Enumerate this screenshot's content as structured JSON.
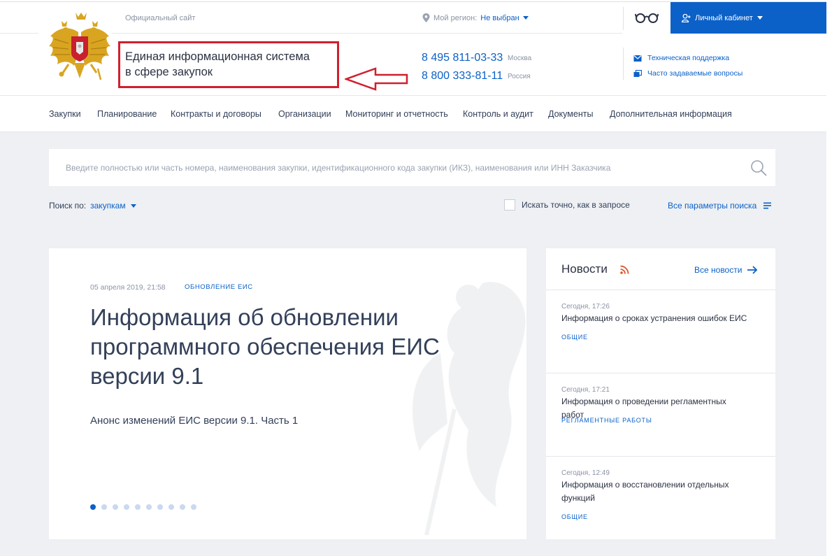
{
  "header": {
    "official_site": "Официальный сайт",
    "region_label": "Мой регион:",
    "region_value": "Не выбран",
    "cabinet_label": "Личный кабинет",
    "title_line1": "Единая информационная система",
    "title_line2": "в сфере закупок",
    "phones": [
      {
        "number": "8 495 811-03-33",
        "city": "Москва"
      },
      {
        "number": "8 800 333-81-11",
        "city": "Россия"
      }
    ],
    "support": [
      {
        "label": "Техническая поддержка",
        "icon": "mail-icon"
      },
      {
        "label": "Часто задаваемые вопросы",
        "icon": "faq-icon"
      }
    ]
  },
  "nav": {
    "items": [
      "Закупки",
      "Планирование",
      "Контракты и договоры",
      "Организации",
      "Мониторинг и отчетность",
      "Контроль и аудит",
      "Документы",
      "Дополнительная информация"
    ]
  },
  "search": {
    "placeholder": "Введите полностью или часть номера, наименования закупки, идентификационного кода закупки (ИКЗ), наименования или ИНН Заказчика",
    "value": "",
    "search_by_label": "Поиск по:",
    "search_by_value": "закупкам",
    "exact_label": "Искать точно, как в запросе",
    "all_params_label": "Все параметры поиска"
  },
  "featured": {
    "date": "05 апреля 2019, 21:58",
    "category": "ОБНОВЛЕНИЕ ЕИС",
    "title": "Информация об обновлении программного обеспечения ЕИС версии 9.1",
    "subtitle": "Анонс изменений ЕИС версии 9.1. Часть 1",
    "slides_total": 10,
    "active_slide": 1
  },
  "news": {
    "heading": "Новости",
    "all_label": "Все новости",
    "items": [
      {
        "time": "Сегодня, 17:26",
        "text": "Информация о сроках устранения ошибок ЕИС",
        "tag": "ОБЩИЕ"
      },
      {
        "time": "Сегодня, 17:21",
        "text": "Информация о проведении регламентных работ",
        "tag": "РЕГЛАМЕНТНЫЕ РАБОТЫ"
      },
      {
        "time": "Сегодня, 12:49",
        "text": "Информация о восстановлении отдельных функций",
        "tag": "ОБЩИЕ"
      }
    ]
  },
  "colors": {
    "accent": "#0b61c8",
    "highlight_box": "#d0202e",
    "background": "#eef0f3"
  }
}
